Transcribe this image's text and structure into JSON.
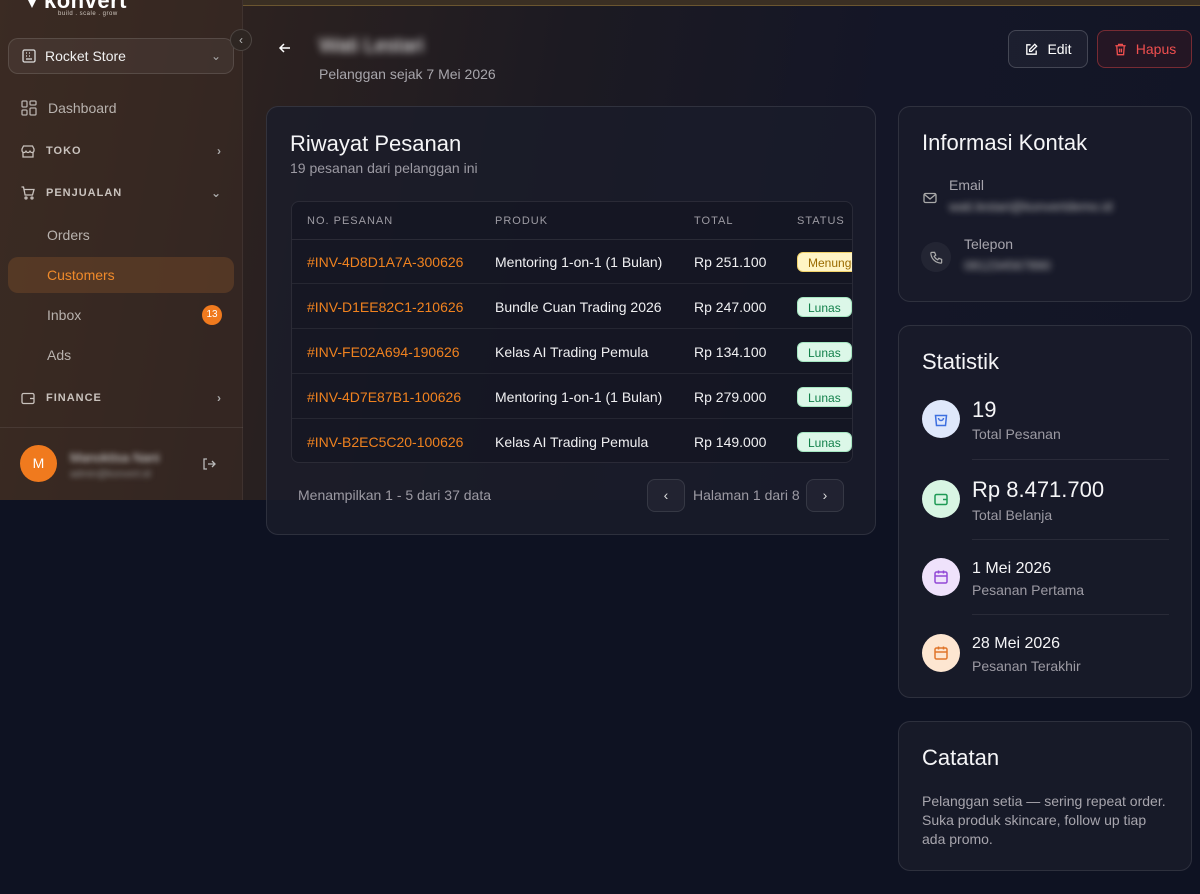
{
  "brand": {
    "name": "konvert",
    "tagline": "build . scale . grow"
  },
  "sidebar": {
    "store": "Rocket Store",
    "items": [
      {
        "label": "Dashboard"
      },
      {
        "label": "TOKO"
      },
      {
        "label": "PENJUALAN"
      },
      {
        "label": "Orders"
      },
      {
        "label": "Customers"
      },
      {
        "label": "Inbox",
        "badge": "13"
      },
      {
        "label": "Ads"
      },
      {
        "label": "FINANCE"
      }
    ],
    "user": {
      "initial": "M",
      "name": "Manoktisa Nani",
      "email": "admin@konvert.id"
    }
  },
  "header": {
    "customer_name": "Wati Lestari",
    "since": "Pelanggan sejak 7 Mei 2026",
    "edit_label": "Edit",
    "delete_label": "Hapus"
  },
  "orders": {
    "title": "Riwayat Pesanan",
    "subtitle": "19 pesanan dari pelanggan ini",
    "columns": [
      "NO. PESANAN",
      "PRODUK",
      "TOTAL",
      "STATUS"
    ],
    "rows": [
      {
        "id": "#INV-4D8D1A7A-300626",
        "product": "Mentoring 1-on-1 (1 Bulan)",
        "total": "Rp 251.100",
        "status": "Menunggu"
      },
      {
        "id": "#INV-D1EE82C1-210626",
        "product": "Bundle Cuan Trading 2026",
        "total": "Rp 247.000",
        "status": "Lunas"
      },
      {
        "id": "#INV-FE02A694-190626",
        "product": "Kelas AI Trading Pemula",
        "total": "Rp 134.100",
        "status": "Lunas"
      },
      {
        "id": "#INV-4D7E87B1-100626",
        "product": "Mentoring 1-on-1 (1 Bulan)",
        "total": "Rp 279.000",
        "status": "Lunas"
      },
      {
        "id": "#INV-B2EC5C20-100626",
        "product": "Kelas AI Trading Pemula",
        "total": "Rp 149.000",
        "status": "Lunas"
      }
    ],
    "showing": "Menampilkan 1 - 5 dari 37 data",
    "page_info": "Halaman 1 dari 8"
  },
  "contact": {
    "title": "Informasi Kontak",
    "email_label": "Email",
    "email_value": "wati.lestari@konvertdemo.id",
    "phone_label": "Telepon",
    "phone_value": "081234567890"
  },
  "stats": {
    "title": "Statistik",
    "items": [
      {
        "value": "19",
        "label": "Total Pesanan"
      },
      {
        "value": "Rp 8.471.700",
        "label": "Total Belanja"
      },
      {
        "value": "1 Mei 2026",
        "label": "Pesanan Pertama"
      },
      {
        "value": "28 Mei 2026",
        "label": "Pesanan Terakhir"
      }
    ]
  },
  "notes": {
    "title": "Catatan",
    "text": "Pelanggan setia — sering repeat order. Suka produk skincare, follow up tiap ada promo."
  },
  "colors": {
    "accent": "#f0821f",
    "danger": "#ef4f4f",
    "paid_bg": "#dcf7e8",
    "waiting_bg": "#fff4c4"
  }
}
